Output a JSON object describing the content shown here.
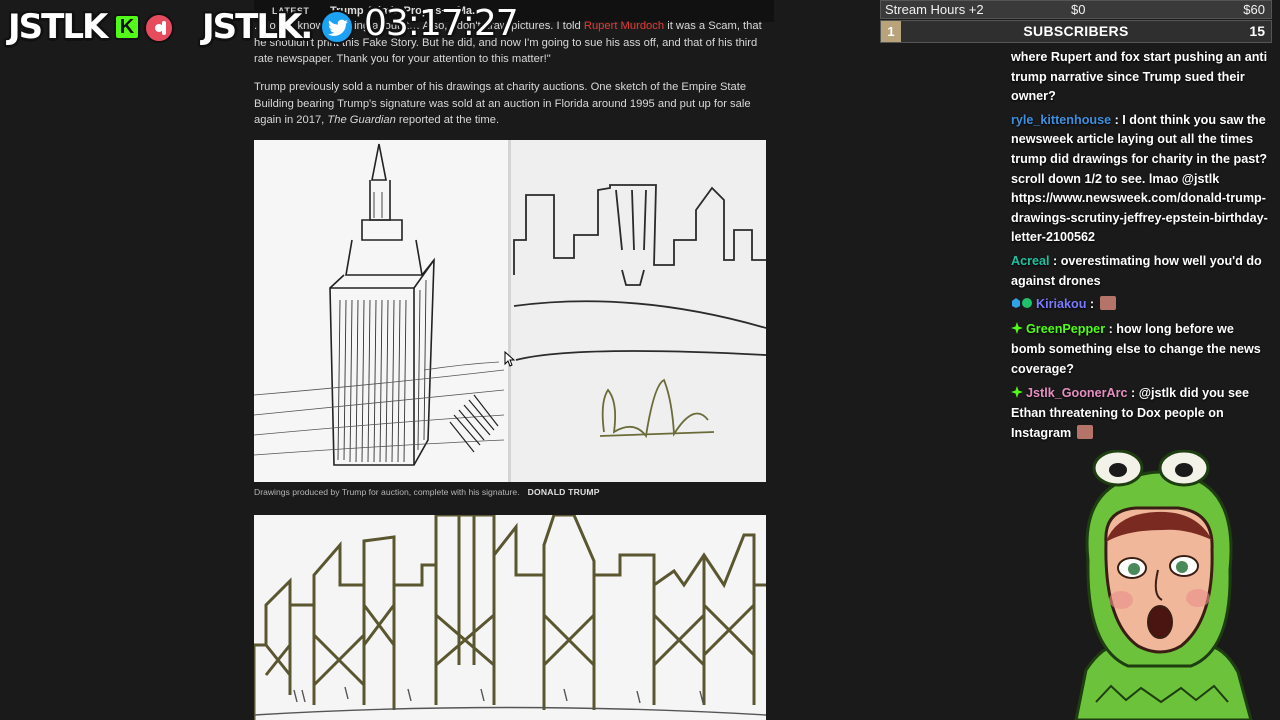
{
  "browser": {
    "top_strip": {
      "latest_label": "LATEST",
      "headline": "Trump Admin Proposes Ma..."
    },
    "article": {
      "para1": {
        "text_before": "...do not know anything about it… Also, I don't draw pictures. I told ",
        "link": "Rupert Murdoch",
        "text_after": " it was a Scam, that he shouldn't print this Fake Story. But he did, and now I'm going to sue his ass off, and that of his third rate newspaper. Thank you for your attention to this matter!\""
      },
      "para2": {
        "text_before": "Trump previously sold a number of his drawings at charity auctions. One sketch of the Empire State Building bearing Trump's signature was sold at an auction in Florida around 1995 and put up for sale again in 2017, ",
        "italic": "The Guardian",
        "text_after": " reported at the time."
      },
      "caption": "Drawings produced by Trump for auction, complete with his signature.",
      "caption_credit": "DONALD TRUMP"
    }
  },
  "overlay": {
    "logo_text_1": "JSTLK",
    "logo_text_2": "JSTLK.",
    "kick_letter": "K",
    "clock": "03:17:27"
  },
  "goal_bar": {
    "label": "Stream Hours +2",
    "current": "$0",
    "target": "$60"
  },
  "subs_bar": {
    "index": "1",
    "title": "SUBSCRIBERS",
    "count": "15"
  },
  "chat": {
    "messages": [
      {
        "user": "",
        "user_color": "#ffffff",
        "text": "where Rupert and fox start pushing an anti trump narrative since Trump sued their owner?"
      },
      {
        "user": "ryle_kittenhouse",
        "user_color": "#3f8fdf",
        "text": "I dont think you saw the newsweek article laying out all the times trump did drawings for charity in the past? scroll down 1/2 to see. lmao @jstlk https://www.newsweek.com/donald-trump-drawings-scrutiny-jeffrey-epstein-birthday-letter-2100562"
      },
      {
        "user": "Acreal",
        "user_color": "#1fc2a0",
        "text": "overestimating how well you'd do against drones"
      },
      {
        "user": "Kiriakou",
        "user_color": "#7a7aff",
        "text": ""
      },
      {
        "user": "GreenPepper",
        "user_color": "#53fc18",
        "text": "how long before we bomb something else to change the news coverage?"
      },
      {
        "user": "Jstlk_GoonerArc",
        "user_color": "#e58fc0",
        "text": "@jstlk did you see Ethan threatening to Dox people on Instagram"
      }
    ]
  },
  "colors": {
    "kick_green": "#53fc18",
    "twitter_blue": "#1da1f2",
    "link_red": "#e53935",
    "subs_gold": "#b9a37a"
  },
  "icons": [
    "twitter-icon",
    "kick-icon",
    "recording-icon",
    "cursor-icon",
    "diamond-badge-icon"
  ]
}
